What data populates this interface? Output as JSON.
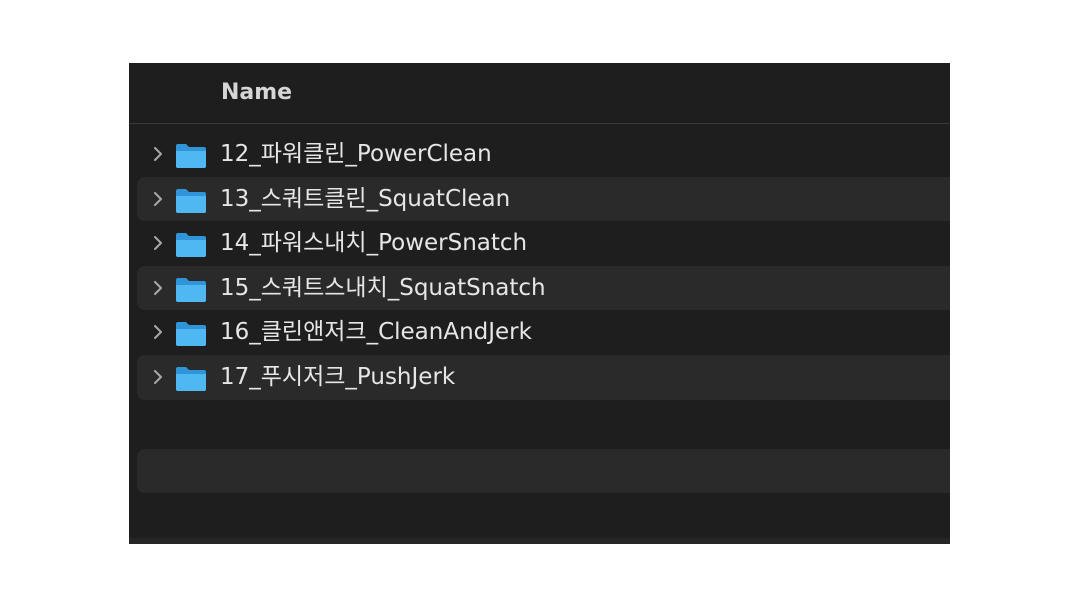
{
  "table": {
    "column_header": "Name"
  },
  "folders": [
    {
      "name": "12_파워클린_PowerClean",
      "icon": "folder-icon",
      "expand_icon": "chevron-right-icon"
    },
    {
      "name": "13_스쿼트클린_SquatClean",
      "icon": "folder-icon",
      "expand_icon": "chevron-right-icon"
    },
    {
      "name": "14_파워스내치_PowerSnatch",
      "icon": "folder-icon",
      "expand_icon": "chevron-right-icon"
    },
    {
      "name": "15_스쿼트스내치_SquatSnatch",
      "icon": "folder-icon",
      "expand_icon": "chevron-right-icon"
    },
    {
      "name": "16_클린앤저크_CleanAndJerk",
      "icon": "folder-icon",
      "expand_icon": "chevron-right-icon"
    },
    {
      "name": "17_푸시저크_PushJerk",
      "icon": "folder-icon",
      "expand_icon": "chevron-right-icon"
    }
  ],
  "colors": {
    "background": "#1e1e1e",
    "alt_row": "#2a2a2a",
    "folder_blue": "#3aa8ea",
    "text": "#e6e6e6"
  }
}
